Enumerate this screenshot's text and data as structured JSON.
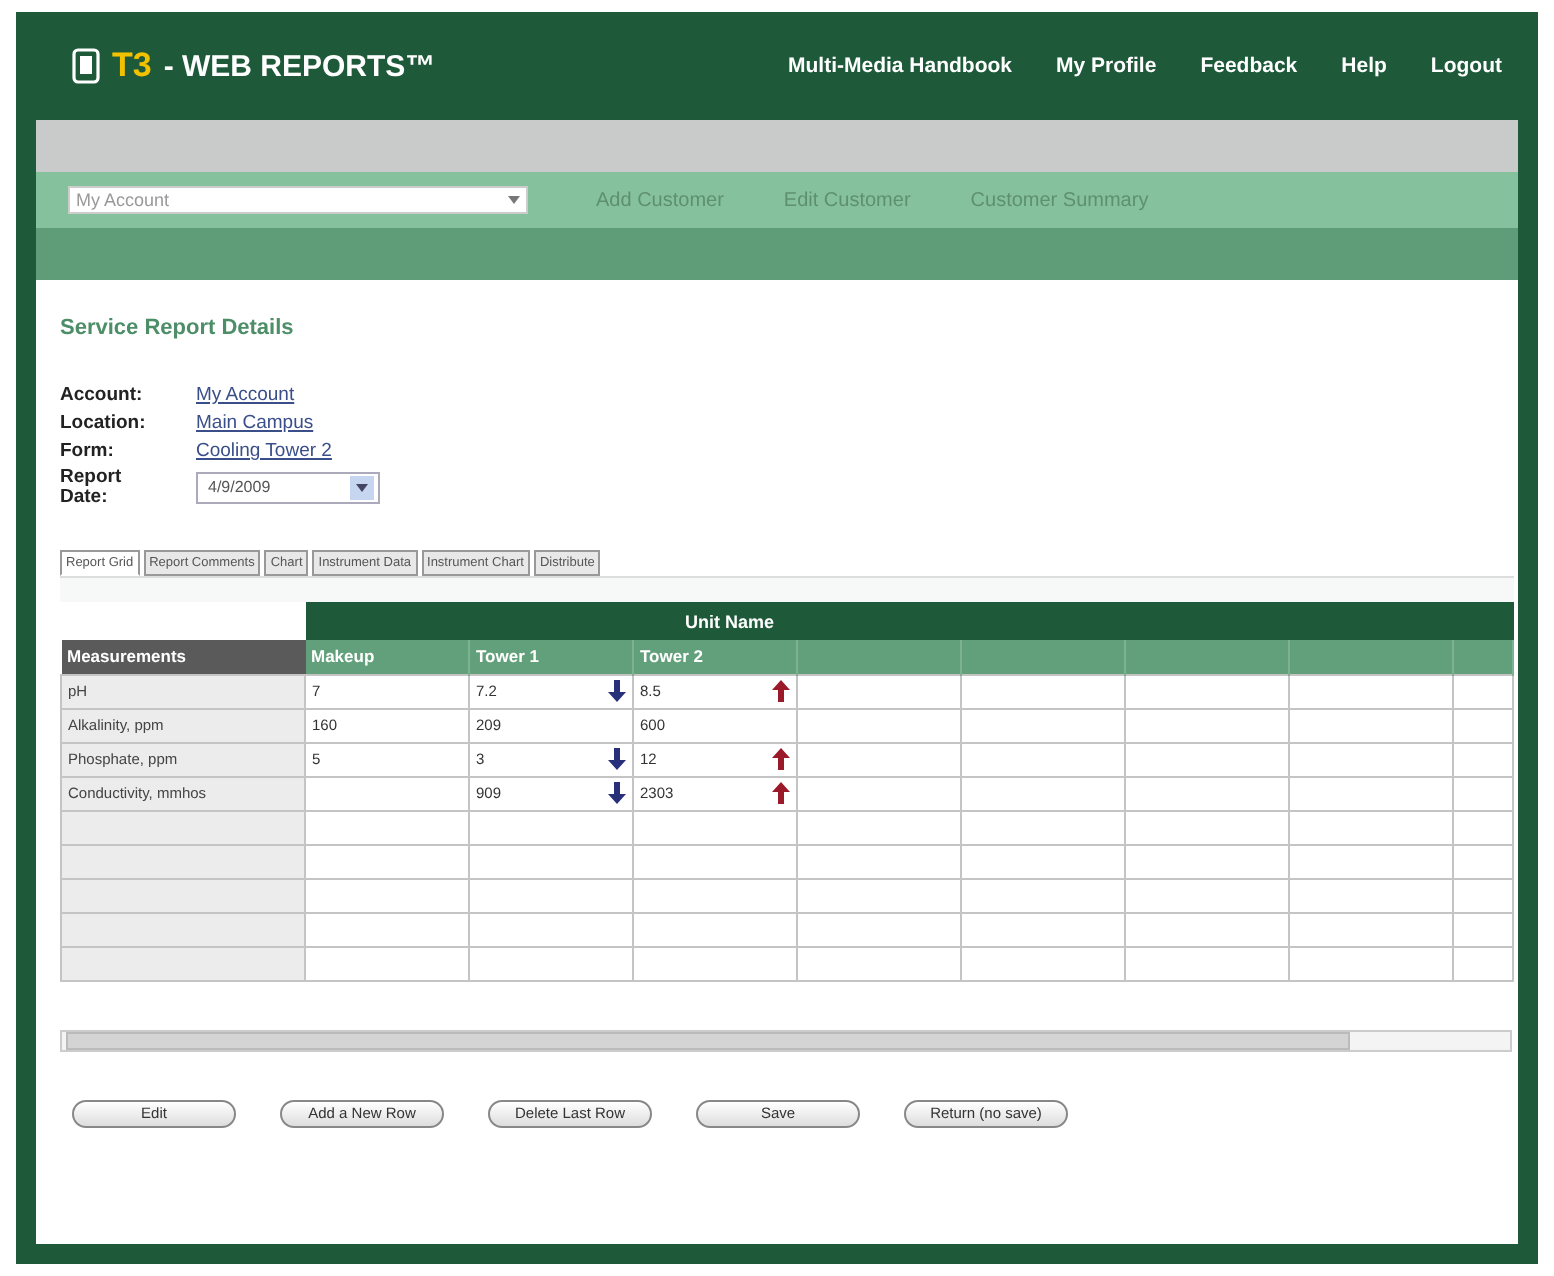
{
  "header": {
    "logo_mark": "T3",
    "logo_title": "- WEB REPORTS™",
    "nav": [
      "Multi-Media Handbook",
      "My Profile",
      "Feedback",
      "Help",
      "Logout"
    ]
  },
  "subnav": {
    "account_select": "My Account",
    "links": [
      "Add Customer",
      "Edit Customer",
      "Customer Summary"
    ]
  },
  "page_title": "Service Report Details",
  "details": [
    {
      "label": "Account:",
      "value": "My Account",
      "kind": "link"
    },
    {
      "label": "Location:",
      "value": "Main Campus",
      "kind": "link"
    },
    {
      "label": "Form:",
      "value": "Cooling Tower 2",
      "kind": "link"
    },
    {
      "label": "Report Date:",
      "value": "4/9/2009",
      "kind": "select"
    }
  ],
  "tabs": [
    {
      "label": "Report Grid",
      "selected": true
    },
    {
      "label": "Report Comments",
      "selected": false
    },
    {
      "label": "Chart",
      "selected": false
    },
    {
      "label": "Instrument Data",
      "selected": false
    },
    {
      "label": "Instrument Chart",
      "selected": false
    },
    {
      "label": "Distribute",
      "selected": false
    }
  ],
  "grid": {
    "group_heading": "Unit Name",
    "row_heading": "Measurements",
    "columns": [
      "Makeup",
      "Tower 1",
      "Tower 2"
    ],
    "rows": [
      {
        "measurement": "pH",
        "cells": [
          {
            "text": "7"
          },
          {
            "text": "7.2",
            "trend_up": false
          },
          {
            "text": "8.5",
            "trend_up": true
          }
        ]
      },
      {
        "measurement": "Alkalinity, ppm",
        "cells": [
          {
            "text": "160"
          },
          {
            "text": "209"
          },
          {
            "text": "600"
          }
        ]
      },
      {
        "measurement": "Phosphate, ppm",
        "cells": [
          {
            "text": "5"
          },
          {
            "text": "3",
            "trend_up": false
          },
          {
            "text": "12",
            "trend_up": true
          }
        ]
      },
      {
        "measurement": "Conductivity, mmhos",
        "cells": [
          {},
          {
            "text": "909",
            "trend_up": false
          },
          {
            "text": "2303",
            "trend_up": true
          }
        ]
      }
    ]
  },
  "buttons": [
    "Edit",
    "Add a New Row",
    "Delete Last Row",
    "Save",
    "Return (no save)"
  ]
}
